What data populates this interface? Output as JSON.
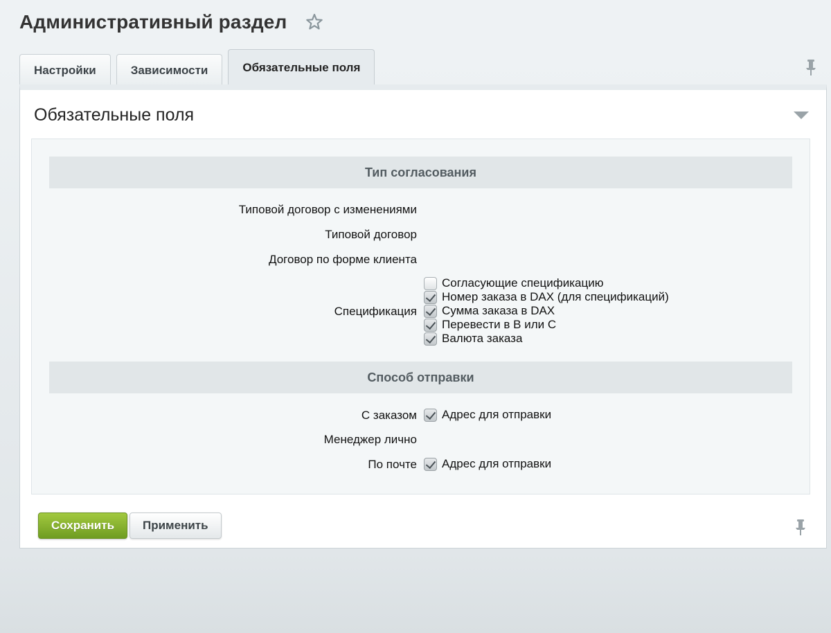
{
  "header": {
    "title": "Административный раздел",
    "favorite_icon": "star-icon"
  },
  "tabs": [
    {
      "label": "Настройки",
      "active": false
    },
    {
      "label": "Зависимости",
      "active": false
    },
    {
      "label": "Обязательные поля",
      "active": true
    }
  ],
  "panel": {
    "title": "Обязательные поля",
    "sections": [
      {
        "title": "Тип согласования",
        "rows": [
          {
            "label": "Типовой договор с изменениями",
            "options": []
          },
          {
            "label": "Типовой договор",
            "options": []
          },
          {
            "label": "Договор по форме клиента",
            "options": []
          },
          {
            "label": "Спецификация",
            "options": [
              {
                "label": "Согласующие спецификацию",
                "checked": false
              },
              {
                "label": "Номер заказа в DAX (для спецификаций)",
                "checked": true
              },
              {
                "label": "Сумма заказа в DAX",
                "checked": true
              },
              {
                "label": "Перевести в B или C",
                "checked": true
              },
              {
                "label": "Валюта заказа",
                "checked": true
              }
            ]
          }
        ]
      },
      {
        "title": "Способ отправки",
        "rows": [
          {
            "label": "С заказом",
            "options": [
              {
                "label": "Адрес для отправки",
                "checked": true
              }
            ]
          },
          {
            "label": "Менеджер лично",
            "options": []
          },
          {
            "label": "По почте",
            "options": [
              {
                "label": "Адрес для отправки",
                "checked": true
              }
            ]
          }
        ]
      }
    ]
  },
  "buttons": {
    "save_label": "Сохранить",
    "apply_label": "Применить"
  },
  "colors": {
    "save_button": "#8ab52f",
    "section_header": "#e1e6e8",
    "form_background": "#f4f7f8"
  }
}
